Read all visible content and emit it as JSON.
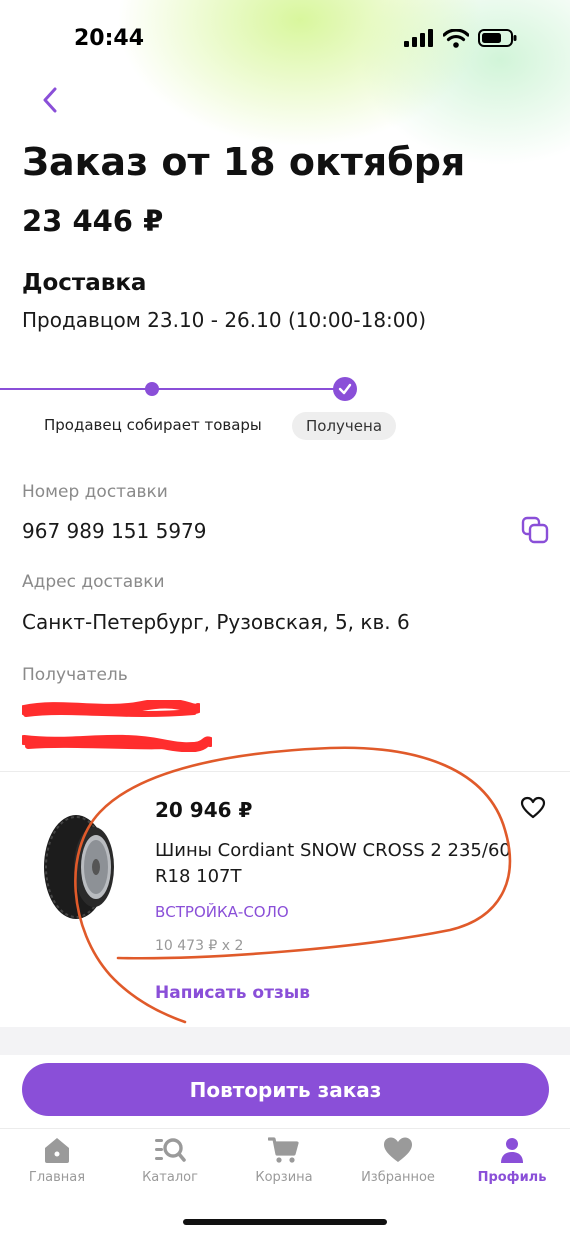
{
  "status_bar": {
    "time": "20:44"
  },
  "header": {
    "title": "Заказ от 18 октября",
    "total": "23 446 ₽"
  },
  "delivery": {
    "heading": "Доставка",
    "text": "Продавцом 23.10 - 26.10 (10:00-18:00)",
    "stages": [
      "Продавец собирает товары",
      "Получена"
    ]
  },
  "details": {
    "number_label": "Номер доставки",
    "number_value": "967 989 151 5979",
    "address_label": "Адрес доставки",
    "address_value": "Санкт-Петербург, Рузовская, 5, кв. 6",
    "recipient_label": "Получатель"
  },
  "product": {
    "price": "20 946 ₽",
    "name": "Шины Cordiant SNOW CROSS 2 235/60 R18 107T",
    "seller": "ВСТРОЙКА-СОЛО",
    "quantity": "10 473 ₽ x 2",
    "review_link": "Написать отзыв"
  },
  "actions": {
    "repeat": "Повторить заказ"
  },
  "tabs": [
    {
      "label": "Главная",
      "icon": "home-icon"
    },
    {
      "label": "Каталог",
      "icon": "catalog-icon"
    },
    {
      "label": "Корзина",
      "icon": "cart-icon"
    },
    {
      "label": "Избранное",
      "icon": "heart-icon"
    },
    {
      "label": "Профиль",
      "icon": "profile-icon"
    }
  ],
  "colors": {
    "accent": "#8a4fd8",
    "annotation": "#e05a2a",
    "redaction": "#ff2d2d"
  }
}
